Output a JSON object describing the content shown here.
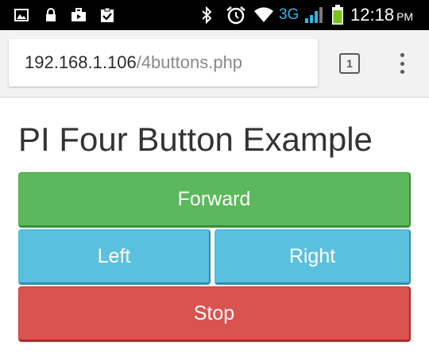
{
  "status_bar": {
    "network": "3G",
    "time": "12:18",
    "ampm": "PM",
    "icons": [
      "image-icon",
      "lock-icon",
      "briefcase-icon",
      "clipboard-check-icon",
      "bluetooth-icon",
      "alarm-icon",
      "wifi-icon",
      "signal-icon",
      "battery-icon"
    ],
    "network_color": "#33b5e5",
    "battery_color": "#7cc31e"
  },
  "browser": {
    "url_host": "192.168.1.106",
    "url_path": "/4buttons.php",
    "tab_count": "1"
  },
  "page": {
    "title": "PI Four Button Example",
    "buttons": {
      "forward": "Forward",
      "left": "Left",
      "right": "Right",
      "stop": "Stop"
    },
    "colors": {
      "forward": "#5cb85c",
      "left": "#5bc0de",
      "right": "#5bc0de",
      "stop": "#d9534f"
    }
  }
}
